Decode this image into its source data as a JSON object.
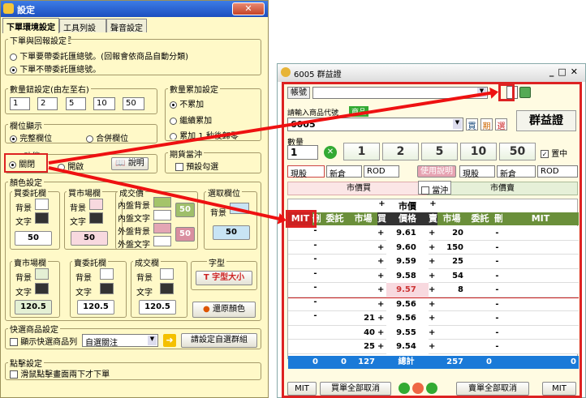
{
  "left": {
    "title": "設定",
    "tabs": [
      "下單環境設定",
      "工具列設定",
      "聲音設定"
    ],
    "g1": {
      "legend": "下單與回報設定",
      "opt1": "下單要帶委託匯總號。(回報會依商品自動分類)",
      "opt2": "下單不帶委託匯總號。"
    },
    "g2": {
      "legend": "數量鈕設定(由左至右)",
      "values": [
        "1",
        "2",
        "5",
        "10",
        "50"
      ]
    },
    "g3": {
      "legend": "數量累加設定",
      "opt1": "不累加",
      "opt2": "繼續累加",
      "opt3": "累加 1 秒後歸零"
    },
    "g4": {
      "legend": "欄位顯示",
      "opt1": "完整欄位",
      "opt2": "合併欄位"
    },
    "g5": {
      "legend": "MIT功能",
      "opt1": "關閉",
      "opt2": "開啟",
      "help": "說明"
    },
    "g6": {
      "legend": "期貨當沖",
      "opt1": "預設勾選"
    },
    "colors": {
      "legend": "顏色設定",
      "buy": {
        "legend": "買委託欄",
        "bg": "背景",
        "fg": "文字",
        "val": "50"
      },
      "buymkt": {
        "legend": "買市場欄",
        "bg": "背景",
        "fg": "文字",
        "val": "50"
      },
      "deal": {
        "legend": "成交價",
        "a": "內盤背景",
        "b": "內盤文字",
        "c": "外盤背景",
        "d": "外盤文字",
        "v1": "50",
        "v2": "50"
      },
      "sel": {
        "legend": "選取欄位",
        "bg": "背景",
        "val": "50"
      },
      "sellmkt": {
        "legend": "賣市場欄",
        "bg": "背景",
        "fg": "文字",
        "val": "120.5"
      },
      "sell": {
        "legend": "賣委託欄",
        "bg": "背景",
        "fg": "文字",
        "val": "120.5"
      },
      "dealcol": {
        "legend": "成交欄",
        "bg": "背景",
        "fg": "文字",
        "val": "120.5"
      },
      "font": {
        "legend": "字型",
        "btn": "字型大小"
      },
      "reset": "還原顏色"
    },
    "quick": {
      "legend": "快選商品設定",
      "label": "顯示快選商品列",
      "select": "自選關注",
      "btn": "請設定自選群組"
    },
    "click": {
      "legend": "點擊設定",
      "label": "滑鼠點擊畫面兩下才下單"
    }
  },
  "right": {
    "title": "6005 群益證",
    "account_label": "帳號",
    "product_label": "請輸入商品代號",
    "product_value": "6005",
    "tab_label": "商品",
    "buttons": {
      "buy_short": "買",
      "period": "期",
      "select": "選"
    },
    "stock_name": "群益證",
    "qty_label": "數量",
    "qty_value": "1",
    "qty_buttons": [
      "1",
      "2",
      "5",
      "10",
      "50"
    ],
    "place_mid": "置中",
    "buy_selects": [
      "現股",
      "新倉",
      "ROD"
    ],
    "sell_selects": [
      "現股",
      "新倉",
      "ROD"
    ],
    "use_help": "使用說明",
    "mkt_buy": "市價買",
    "mkt_sell": "市價賣",
    "daytrade": "當沖",
    "row_plus_mkt": "市價",
    "headers": [
      "MIT",
      "刪",
      "委託",
      "市場",
      "買",
      "價格",
      "賣",
      "市場",
      "委託",
      "刪",
      "MIT"
    ],
    "rows": [
      {
        "bm": "",
        "pr": "9.61",
        "sm": "20"
      },
      {
        "bm": "",
        "pr": "9.60",
        "sm": "150"
      },
      {
        "bm": "",
        "pr": "9.59",
        "sm": "25"
      },
      {
        "bm": "",
        "pr": "9.58",
        "sm": "54"
      },
      {
        "bm": "",
        "pr": "9.57",
        "sm": "8"
      },
      {
        "bm": "",
        "pr": "9.56",
        "sm": ""
      },
      {
        "bm": "21",
        "pr": "9.56",
        "sm": ""
      },
      {
        "bm": "40",
        "pr": "9.55",
        "sm": ""
      },
      {
        "bm": "25",
        "pr": "9.54",
        "sm": ""
      }
    ],
    "totals": {
      "a": "0",
      "b": "0",
      "c": "127",
      "label": "總計",
      "d": "257",
      "e": "0",
      "f": "0"
    },
    "bottom": {
      "mit": "MIT",
      "cancel_buy": "買單全部取消",
      "cancel_sell": "賣單全部取消",
      "mit2": "MIT"
    }
  }
}
